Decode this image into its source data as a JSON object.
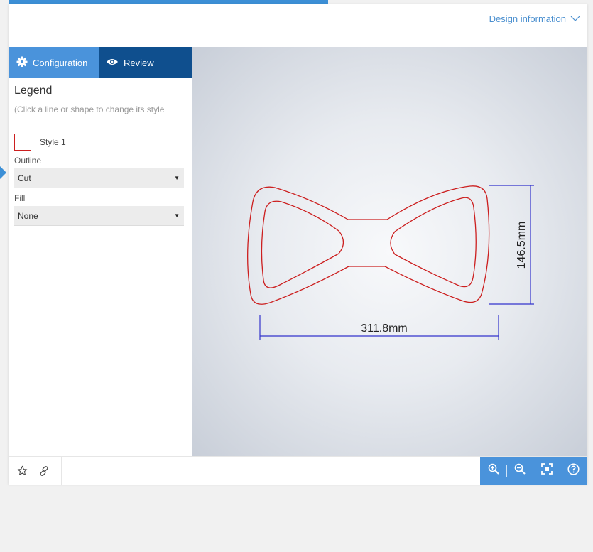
{
  "header": {
    "design_info_label": "Design information"
  },
  "sidebar": {
    "tabs": [
      {
        "label": "Configuration",
        "icon": "gear-icon",
        "active": true
      },
      {
        "label": "Review",
        "icon": "eye-icon",
        "active": false
      }
    ],
    "legend": {
      "title": "Legend",
      "hint": "(Click a line or shape to change its style"
    },
    "style": {
      "name": "Style 1",
      "swatch_color": "#cc1f1f",
      "outline_label": "Outline",
      "outline_value": "Cut",
      "fill_label": "Fill",
      "fill_value": "None"
    }
  },
  "canvas": {
    "width_dimension": "311.8mm",
    "height_dimension": "146.5mm",
    "shape_color": "#cc1f1f",
    "dimension_color": "#3333cc"
  },
  "bottom_bar": {
    "left_icons": [
      "star-icon",
      "link-icon"
    ],
    "zoom_controls": [
      "zoom-in-icon",
      "zoom-out-icon",
      "fit-screen-icon",
      "help-icon"
    ]
  },
  "colors": {
    "accent": "#4a93db",
    "accent_dark": "#0f4f8e",
    "link": "#4a8fcf"
  }
}
